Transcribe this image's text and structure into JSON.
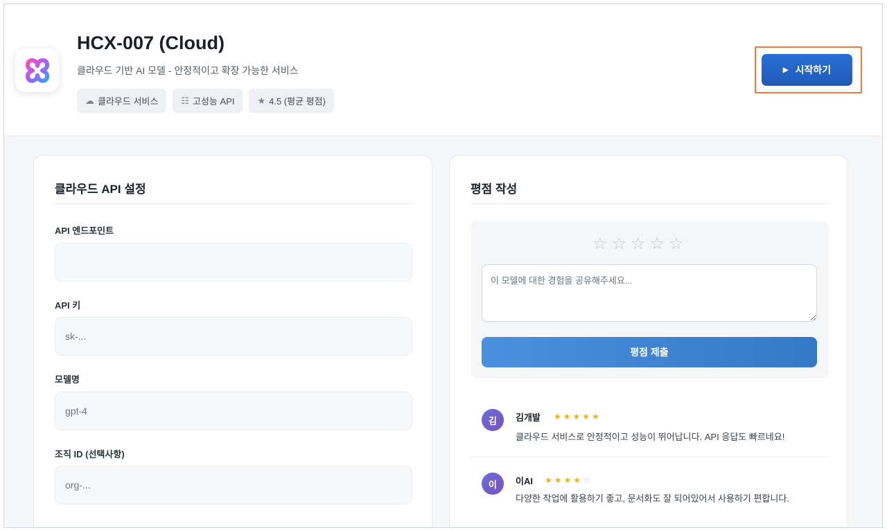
{
  "header": {
    "title": "HCX-007 (Cloud)",
    "subtitle": "클라우드 기반 AI 모델 - 안정적이고 확장 가능한 서비스",
    "tags": [
      {
        "icon": "cloud-icon",
        "glyph": "☁",
        "label": "클라우드 서비스"
      },
      {
        "icon": "sliders-icon",
        "glyph": "☷",
        "label": "고성능 API"
      },
      {
        "icon": "star-icon",
        "glyph": "★",
        "label": "4.5 (평균 평점)"
      }
    ],
    "start_label": "시작하기"
  },
  "api_settings": {
    "title": "클라우드 API 설정",
    "fields": [
      {
        "label": "API 엔드포인트",
        "value": "",
        "placeholder": ""
      },
      {
        "label": "API 키",
        "value": "",
        "placeholder": "sk-..."
      },
      {
        "label": "모델명",
        "value": "gpt-4",
        "placeholder": ""
      },
      {
        "label": "조직 ID (선택사항)",
        "value": "",
        "placeholder": "org-..."
      }
    ]
  },
  "rating": {
    "title": "평점 작성",
    "selected_stars": 0,
    "max_stars": 5,
    "textarea_placeholder": "이 모델에 대한 경험을 공유해주세요...",
    "submit_label": "평점 제출"
  },
  "reviews": [
    {
      "initial": "김",
      "name": "김개발",
      "stars": 5,
      "text": "클라우드 서비스로 안정적이고 성능이 뛰어납니다. API 응답도 빠르네요!"
    },
    {
      "initial": "이",
      "name": "이AI",
      "stars": 4,
      "text": "다양한 작업에 활용하기 좋고, 문서화도 잘 되어있어서 사용하기 편합니다."
    }
  ],
  "colors": {
    "accent": "#1f5bb8",
    "highlight_outline": "#ef7a3a",
    "star_filled": "#f5b301"
  }
}
